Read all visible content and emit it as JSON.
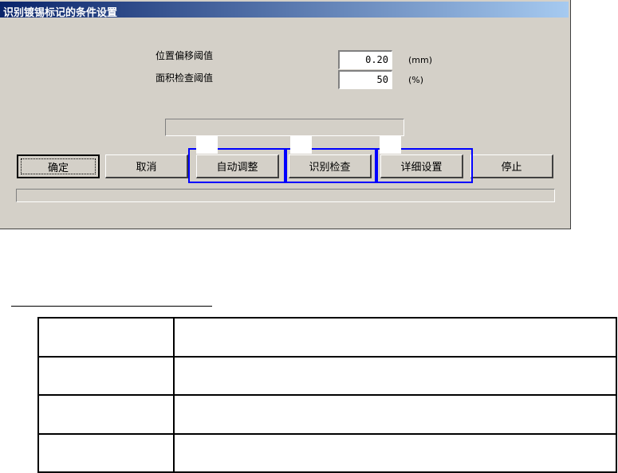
{
  "window": {
    "title": "识别镀锡标记的条件设置"
  },
  "fields": {
    "position_offset": {
      "label": "位置偏移阈值",
      "value": "0.20",
      "unit": "(mm)"
    },
    "area_check": {
      "label": "面积检查阈值",
      "value": "50",
      "unit": "(%)"
    }
  },
  "buttons": {
    "ok": "确定",
    "cancel": "取消",
    "auto_adjust": "自动调整",
    "recognize_check": "识别检查",
    "detail_settings": "详细设置",
    "stop": "停止"
  },
  "table": {
    "rows": [
      {
        "key": "",
        "desc": ""
      },
      {
        "key": "",
        "desc": ""
      },
      {
        "key": "",
        "desc": ""
      },
      {
        "key": "",
        "desc": ""
      }
    ]
  }
}
